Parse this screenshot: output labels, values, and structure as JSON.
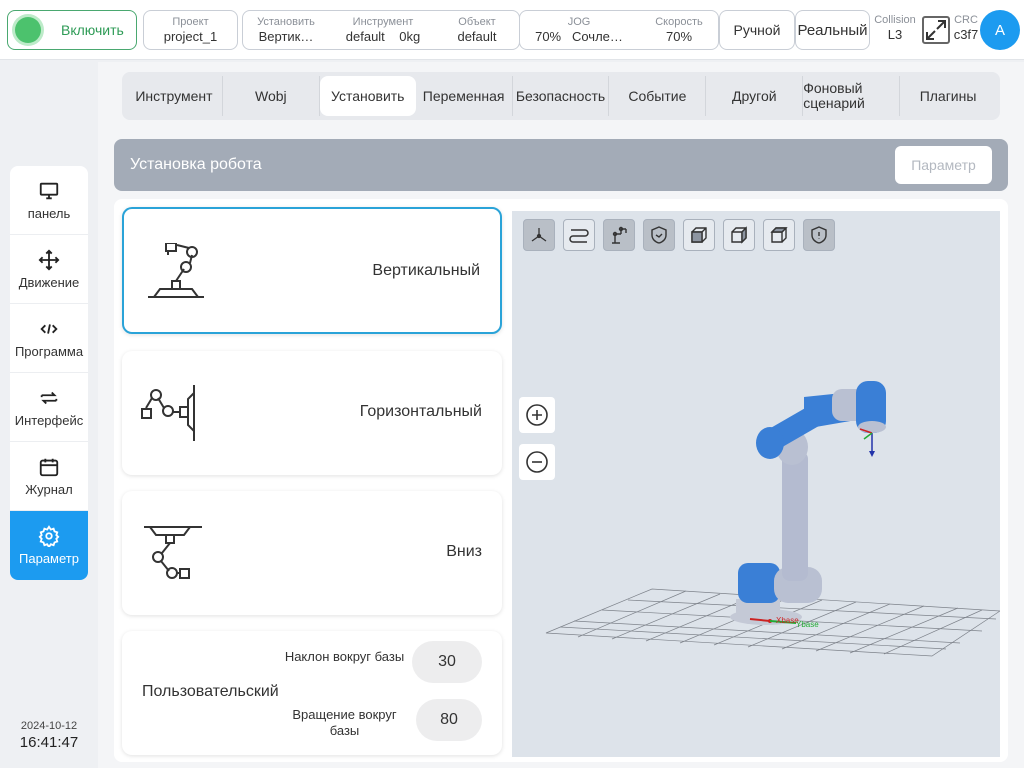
{
  "topbar": {
    "enable_label": "Включить",
    "cells": [
      {
        "label": "Проект",
        "value": "project_1"
      },
      {
        "label": "Установить",
        "value": "Вертик…"
      },
      {
        "label": "Инструмент",
        "value": "default",
        "value2": "0kg"
      },
      {
        "label": "Объект",
        "value": "default"
      },
      {
        "label": "JOG",
        "value": "70%",
        "value2": "Сочле…"
      },
      {
        "label": "Скорость",
        "value": "70%"
      }
    ],
    "mode_manual": "Ручной",
    "mode_real": "Реальный",
    "collision_label": "Collision",
    "collision_value": "L3",
    "crc_label": "CRC",
    "crc_value": "c3f7",
    "avatar_letter": "A"
  },
  "sidebar": {
    "items": [
      {
        "label": "панель",
        "icon": "monitor-icon"
      },
      {
        "label": "Движение",
        "icon": "move-arrows-icon"
      },
      {
        "label": "Программа",
        "icon": "code-icon"
      },
      {
        "label": "Интерфейс",
        "icon": "sync-arrows-icon"
      },
      {
        "label": "Журнал",
        "icon": "calendar-icon"
      },
      {
        "label": "Параметр",
        "icon": "gear-icon",
        "active": true
      }
    ],
    "date": "2024-10-12",
    "time": "16:41:47"
  },
  "tabs": [
    {
      "label": "Инструмент"
    },
    {
      "label": "Wobj"
    },
    {
      "label": "Установить",
      "active": true
    },
    {
      "label": "Переменная"
    },
    {
      "label": "Безопасность"
    },
    {
      "label": "Событие"
    },
    {
      "label": "Другой"
    },
    {
      "label": "Фоновый сценарий"
    },
    {
      "label": "Плагины"
    }
  ],
  "section": {
    "title": "Установка робота",
    "param_button": "Параметр"
  },
  "mount_options": [
    {
      "label": "Вертикальный",
      "icon": "robot-vertical-icon",
      "selected": true
    },
    {
      "label": "Горизонтальный",
      "icon": "robot-horizontal-icon"
    },
    {
      "label": "Вниз",
      "icon": "robot-ceiling-icon"
    }
  ],
  "custom": {
    "title": "Пользовательский",
    "tilt_label": "Наклон вокруг базы",
    "tilt_value": "30",
    "rotation_label": "Вращение вокруг базы",
    "rotation_value": "80"
  },
  "viewer": {
    "axis_labels": {
      "x": "Xbase",
      "y": "Ybase"
    },
    "colors": {
      "robot_blue": "#3a7fd6",
      "robot_grey": "#b9c0d2",
      "background": "#dde3ea"
    }
  }
}
